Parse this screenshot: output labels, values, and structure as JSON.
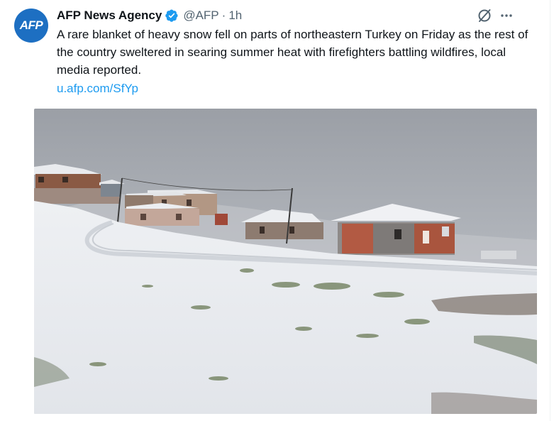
{
  "tweet": {
    "avatar_text": "AFP",
    "author_name": "AFP News Agency",
    "verified_icon": "verified-badge-icon",
    "handle": "@AFP",
    "separator": "·",
    "time": "1h",
    "text": "A rare blanket of heavy snow fell on parts of northeastern Turkey on Friday as the rest of the country sweltered in searing summer heat with firefighters battling wildfires, local media reported.",
    "link": "u.afp.com/SfYp",
    "icons": {
      "grok": "grok-icon",
      "more": "more-dots-icon"
    }
  },
  "colors": {
    "text": "#0f1419",
    "secondary": "#536471",
    "link": "#1d9bf0",
    "verified": "#1d9bf0",
    "avatar_bg": "#1d6fc2"
  }
}
